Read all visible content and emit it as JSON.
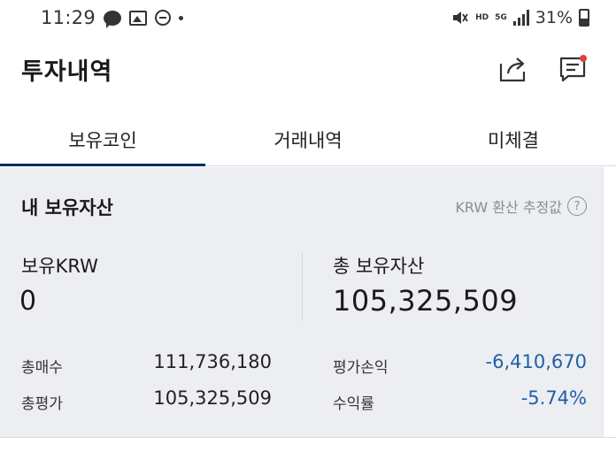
{
  "status_bar": {
    "time": "11:29",
    "battery": "31%",
    "icons": [
      "chat-icon",
      "gallery-icon",
      "dnd-icon",
      "mute-icon",
      "hd-icon",
      "5g-icon",
      "signal-icon",
      "battery-icon"
    ],
    "badge_hd": "HD",
    "badge_5g": "5G"
  },
  "header": {
    "title": "투자내역",
    "share_icon": "share-icon",
    "message_icon": "message-icon"
  },
  "tabs": [
    {
      "label": "보유코인",
      "active": true
    },
    {
      "label": "거래내역",
      "active": false
    },
    {
      "label": "미체결",
      "active": false
    }
  ],
  "assets": {
    "title": "내 보유자산",
    "estimate_label": "KRW 환산 추정값",
    "help_label": "?",
    "krw_label": "보유KRW",
    "krw_value": "0",
    "total_label": "총 보유자산",
    "total_value": "105,325,509",
    "rows": [
      {
        "label": "총매수",
        "value": "111,736,180"
      },
      {
        "label": "총평가",
        "value": "105,325,509"
      },
      {
        "label": "평가손익",
        "value": "-6,410,670"
      },
      {
        "label": "수익률",
        "value": "-5.74%"
      }
    ]
  },
  "colors": {
    "accent": "#0b2a63",
    "negative": "#1f5fa6",
    "card_bg": "#edeef2",
    "notification_dot": "#e0403a"
  }
}
